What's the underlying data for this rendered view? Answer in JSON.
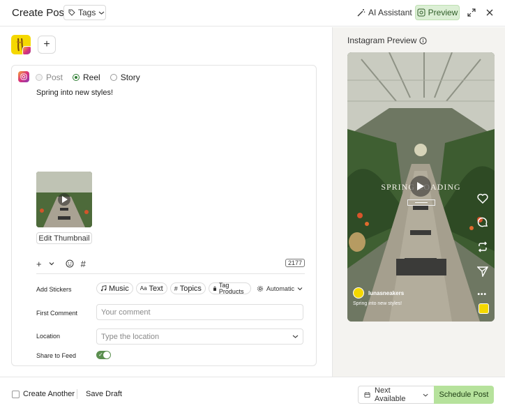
{
  "header": {
    "title": "Create Post",
    "tags_label": "Tags",
    "ai_label": "AI Assistant",
    "preview_label": "Preview",
    "icons": [
      "tag-icon",
      "chevron-down-icon",
      "magic-wand-icon",
      "eye-icon",
      "expand-icon",
      "close-icon"
    ]
  },
  "composer": {
    "add_account_label": "+",
    "post_types": [
      {
        "label": "Post",
        "state": "disabled"
      },
      {
        "label": "Reel",
        "state": "checked"
      },
      {
        "label": "Story",
        "state": "unchecked"
      }
    ],
    "caption": "Spring into new styles!",
    "edit_thumbnail_label": "Edit Thumbnail",
    "toolbar": {
      "plus": "+",
      "hashtag": "#",
      "char_count": "2177"
    },
    "stickers": {
      "label": "Add Stickers",
      "items": [
        {
          "icon": "music-icon",
          "label": "Music"
        },
        {
          "icon": "text-icon",
          "glyph": "Aa",
          "label": "Text"
        },
        {
          "icon": "hashtag-icon",
          "glyph": "#",
          "label": "Topics"
        },
        {
          "icon": "tag-product-icon",
          "label": "Tag Products"
        }
      ],
      "mode": "Automatic"
    },
    "first_comment": {
      "label": "First Comment",
      "placeholder": "Your comment"
    },
    "location": {
      "label": "Location",
      "placeholder": "Type the location"
    },
    "share_to_feed": {
      "label": "Share to Feed",
      "enabled": true
    }
  },
  "preview": {
    "title": "Instagram Preview",
    "overlay_text": "SPRING LOADING",
    "username": "lunasneakers",
    "caption": "Spring into new styles!",
    "more": "•••"
  },
  "footer": {
    "create_another": "Create Another",
    "save_draft": "Save Draft",
    "next_available": "Next Available",
    "schedule": "Schedule Post"
  },
  "colors": {
    "accent_green": "#b6e29c",
    "preview_active": "#dcefd5",
    "toggle_on": "#5b8f4f"
  }
}
